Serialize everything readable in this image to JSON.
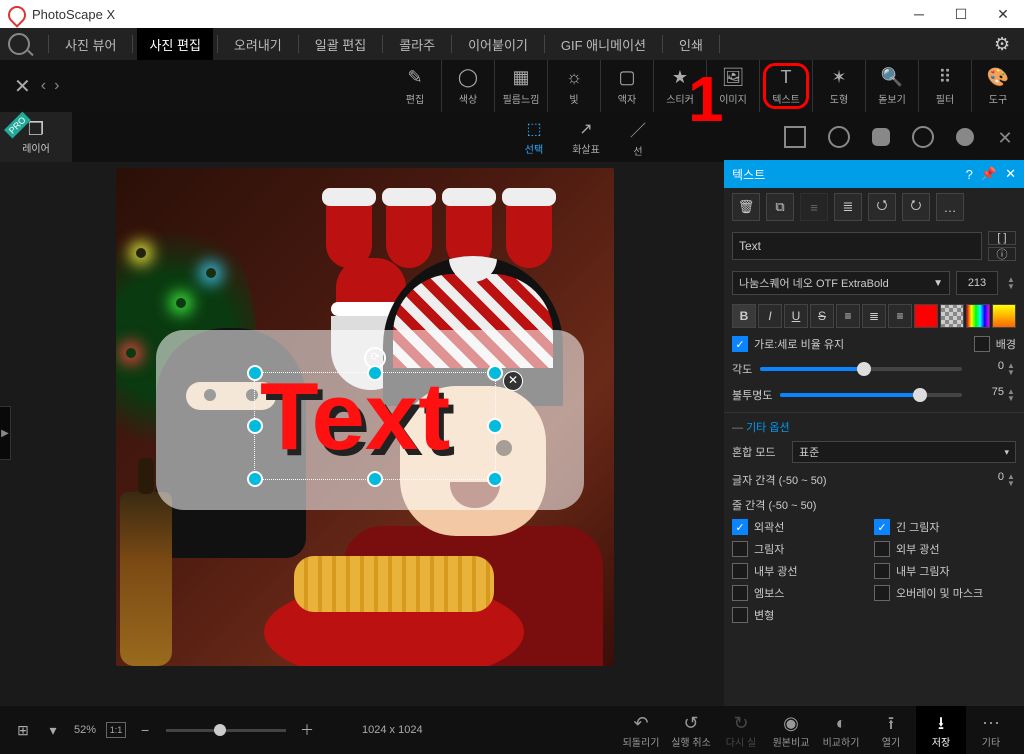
{
  "app": {
    "title": "PhotoScape X"
  },
  "menu": {
    "viewer": "사진 뷰어",
    "editor": "사진 편집",
    "cutout": "오려내기",
    "batch": "일괄 편집",
    "collage": "콜라주",
    "combine": "이어붙이기",
    "gif": "GIF 애니메이션",
    "print": "인쇄"
  },
  "tools": {
    "edit": "편집",
    "color": "색상",
    "film": "필름느낌",
    "light": "빛",
    "frame": "액자",
    "sticker": "스티커",
    "image": "이미지",
    "text": "텍스트",
    "shape": "도형",
    "magnifier": "돋보기",
    "filter": "필터",
    "tools": "도구"
  },
  "subtools": {
    "layer": "레이어",
    "select": "선택",
    "arrow": "화살표",
    "line": "선"
  },
  "annotation": {
    "big1": "1"
  },
  "canvas": {
    "sample_text": "Text"
  },
  "panel": {
    "title": "텍스트",
    "text_value": "Text",
    "font": "나눔스퀘어 네오 OTF ExtraBold",
    "size": "213",
    "keep_ratio": "가로:세로 비율 유지",
    "background": "배경",
    "angle": "각도",
    "angle_val": "0",
    "opacity": "불투명도",
    "opacity_val": "75",
    "more_options": "기타 옵션",
    "blend": "혼합 모드",
    "blend_val": "표준",
    "lspace": "글자 간격 (-50 ~ 50)",
    "lspace_val": "0",
    "linespace": "줄 간격 (-50 ~ 50)",
    "chk_outline": "외곽선",
    "chk_longshadow": "긴 그림자",
    "chk_shadow": "그림자",
    "chk_outerglow": "외부 광선",
    "chk_innerglow": "내부 광선",
    "chk_innershadow": "내부 그림자",
    "chk_emboss": "엠보스",
    "chk_overlay": "오버레이 및 마스크",
    "chk_deform": "변형"
  },
  "bottom": {
    "zoom": "52%",
    "dims": "1024 x 1024",
    "undo": "되돌리기",
    "undohist": "실행 취소",
    "redo": "다시 실",
    "compare": "원본비교",
    "compare2": "비교하기",
    "open": "열기",
    "save": "저장",
    "more": "기타"
  }
}
